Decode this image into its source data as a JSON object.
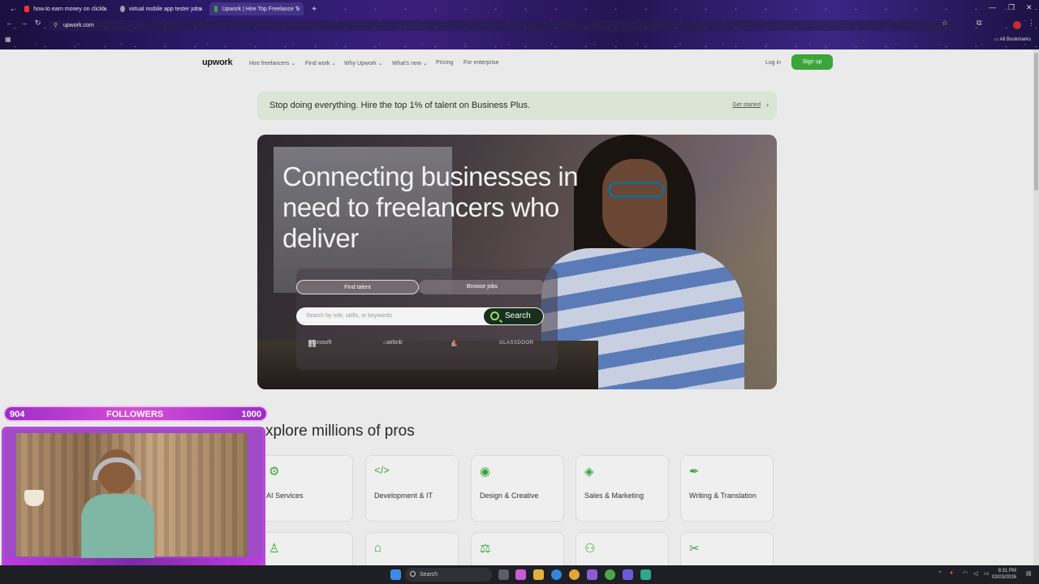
{
  "browser": {
    "tabs": [
      {
        "title": "how to earn money on clickb",
        "icon_color": "#ff3030"
      },
      {
        "title": "virtual mobile app tester jobs",
        "icon_color": "#9aa0a6"
      },
      {
        "title": "Upwork | Hire Top Freelance T",
        "icon_color": "#3aa63a"
      }
    ],
    "url": "upwork.com",
    "bookmarks_label": "All Bookmarks"
  },
  "nav": {
    "logo": "upwork",
    "links": [
      "Hire freelancers",
      "Find work",
      "Why Upwork",
      "What's new",
      "Pricing",
      "For enterprise"
    ],
    "login": "Log in",
    "signup": "Sign up"
  },
  "banner": {
    "text": "Stop doing everything. Hire the top 1% of talent on Business Plus.",
    "cta": "Get started"
  },
  "hero": {
    "title": "Connecting businesses in need to freelancers who deliver",
    "tab_find": "Find talent",
    "tab_browse": "Browse jobs",
    "search_placeholder": "Search by role, skills, or keywords",
    "search_button": "Search",
    "logos": [
      "Microsoft",
      "airbnb",
      "GLASSDOOR"
    ]
  },
  "explore": {
    "heading": "xplore millions of pros",
    "categories": [
      {
        "label": "AI Services",
        "icon": "ai-icon"
      },
      {
        "label": "Development & IT",
        "icon": "code-icon"
      },
      {
        "label": "Design & Creative",
        "icon": "palette-icon"
      },
      {
        "label": "Sales & Marketing",
        "icon": "tag-icon"
      },
      {
        "label": "Writing & Translation",
        "icon": "pen-icon"
      }
    ]
  },
  "overlay": {
    "followers_current": "904",
    "followers_label": "FOLLOWERS",
    "followers_goal": "1000"
  },
  "taskbar": {
    "search": "Search",
    "time": "9:31 PM",
    "date": "02/03/2026"
  }
}
